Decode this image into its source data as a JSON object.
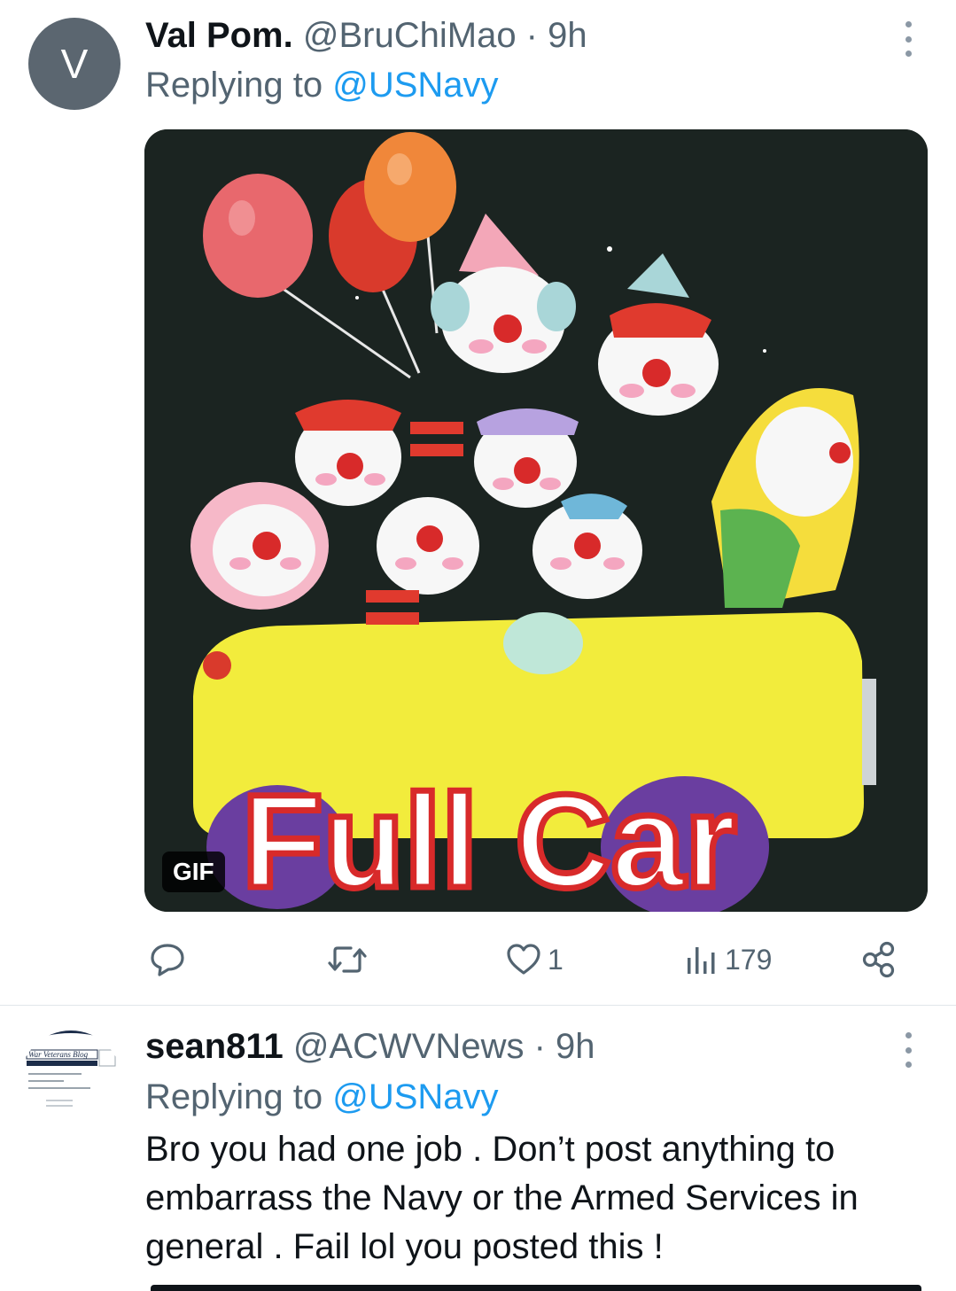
{
  "tweets": [
    {
      "avatar_letter": "V",
      "display_name": "Val Pom.",
      "handle": "@BruChiMao",
      "time": " · 9h",
      "replying_prefix": "Replying to ",
      "replying_to": "@USNavy",
      "media": {
        "badge": "GIF",
        "caption": "Full Car",
        "icon": "clown-car-gif"
      },
      "stats": {
        "replies": "",
        "retweets": "",
        "likes": "1",
        "views": "179"
      }
    },
    {
      "avatar_text": "War Veterans Blog",
      "display_name": "sean811",
      "handle": "@ACWVNews",
      "time": " · 9h",
      "replying_prefix": "Replying to ",
      "replying_to": "@USNavy",
      "text": "Bro you had one job . Don’t post anything to embarrass the Navy or the Armed Services in general  . Fail lol  you posted this !"
    }
  ],
  "icons": {
    "reply": "reply-icon",
    "retweet": "retweet-icon",
    "like": "heart-icon",
    "views": "views-chart-icon",
    "share": "share-icon",
    "more": "more-vertical-icon"
  },
  "colors": {
    "mention": "#1d9bf0",
    "secondary": "#536471",
    "primary_text": "#0f1419",
    "media_bg": "#1b2421"
  }
}
